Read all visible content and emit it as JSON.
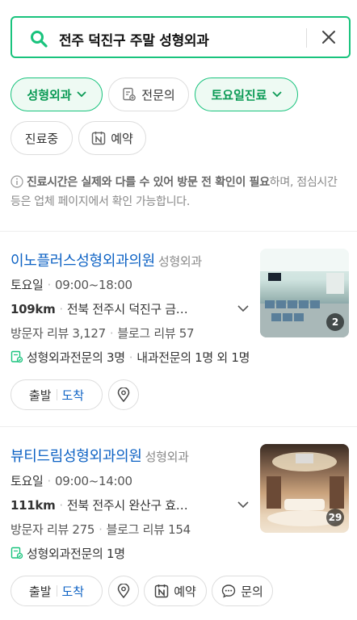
{
  "search": {
    "query": "전주 덕진구  주말 성형외과"
  },
  "filters": [
    {
      "label": "성형외과",
      "active": true,
      "icon": "chevron-down-icon"
    },
    {
      "label": "전문의",
      "active": false,
      "icon": "specialist-doc-icon"
    },
    {
      "label": "토요일진료",
      "active": true,
      "icon": "chevron-down-icon"
    },
    {
      "label": "진료중",
      "active": false
    },
    {
      "label": "예약",
      "active": false,
      "icon": "naver-reserve-icon"
    }
  ],
  "notice": {
    "bold": "진료시간은 실제와 다를 수 있어 방문 전 확인이 필요",
    "rest": "하며, 점심시간 등은 업체 페이지에서 확인 가능합니다."
  },
  "results": [
    {
      "name": "이노플러스성형외과의원",
      "category": "성형외과",
      "day": "토요일",
      "hours": "09:00~18:00",
      "distance": "109km",
      "address": "전북 전주시 덕진구 금…",
      "visitor_reviews": "방문자 리뷰 3,127",
      "blog_reviews": "블로그 리뷰 57",
      "specialists": "성형외과전문의 3명",
      "specialists_extra": "내과전문의 1명 외 1명",
      "photo_count": "2",
      "depart": "출발",
      "arrive": "도착"
    },
    {
      "name": "뷰티드림성형외과의원",
      "category": "성형외과",
      "day": "토요일",
      "hours": "09:00~14:00",
      "distance": "111km",
      "address": "전북 전주시 완산구 효…",
      "visitor_reviews": "방문자 리뷰 275",
      "blog_reviews": "블로그 리뷰 154",
      "specialists": "성형외과전문의 1명",
      "photo_count": "29",
      "depart": "출발",
      "arrive": "도착",
      "reserve": "예약",
      "inquiry": "문의"
    }
  ],
  "colors": {
    "accent": "#19c37d",
    "link": "#0d62c4"
  }
}
